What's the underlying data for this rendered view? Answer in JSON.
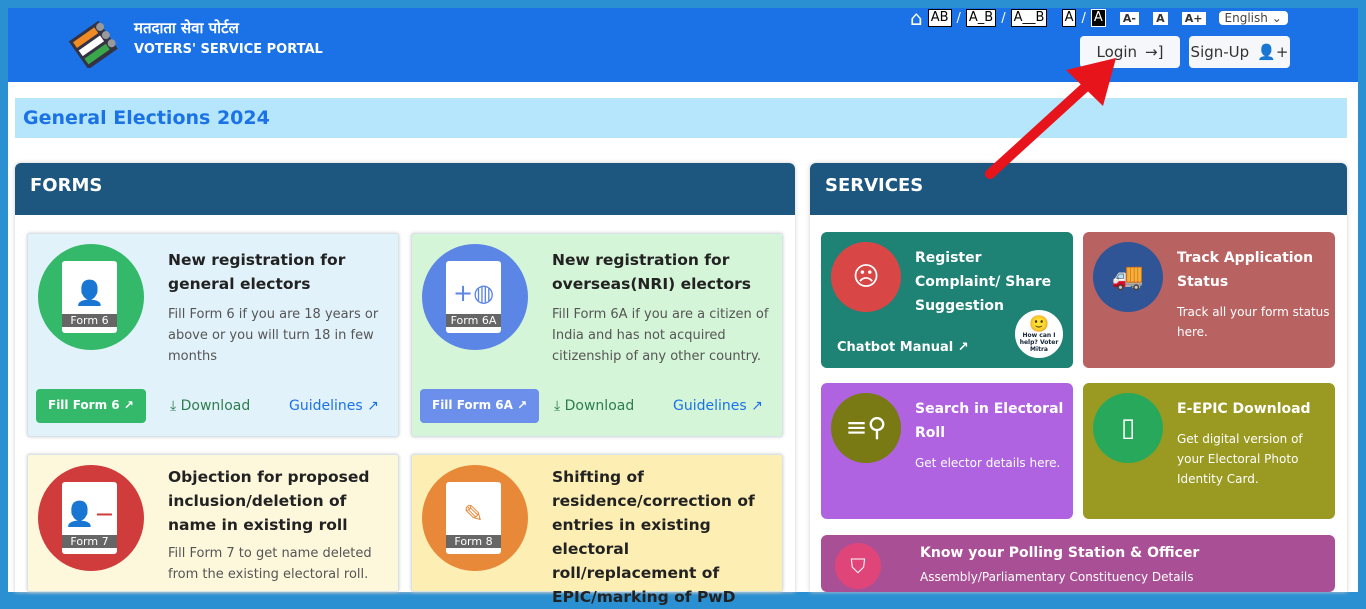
{
  "header": {
    "title_hi": "मतदाता सेवा पोर्टल",
    "title_en": "VOTERS' SERVICE PORTAL",
    "accessibility": [
      "AB",
      "A_B",
      "A__B",
      "A",
      "A",
      "A-",
      "A",
      "A+"
    ],
    "language": "English",
    "login": "Login",
    "signup": "Sign-Up"
  },
  "banner": "General Elections 2024",
  "forms": {
    "title": "FORMS",
    "cards": [
      {
        "badge": "Form 6",
        "title": "New registration for general electors",
        "desc": "Fill Form 6 if you are 18 years or above or you will turn 18 in few months",
        "fill": "Fill Form 6",
        "download": "Download",
        "guidelines": "Guidelines",
        "color": "#34b96a"
      },
      {
        "badge": "Form 6A",
        "title": "New registration for overseas(NRI) electors",
        "desc": "Fill Form 6A if you are a citizen of India and has not acquired citizenship of any other country.",
        "fill": "Fill Form 6A",
        "download": "Download",
        "guidelines": "Guidelines",
        "color": "#5b86e5"
      },
      {
        "badge": "Form 7",
        "title": "Objection for proposed inclusion/deletion of name in existing roll",
        "desc": "Fill Form 7 to get name deleted from the existing electoral roll.",
        "color": "#d03b3b"
      },
      {
        "badge": "Form 8",
        "title": "Shifting of residence/correction of entries in existing electoral roll/replacement of EPIC/marking of PwD",
        "color": "#e8893a"
      }
    ]
  },
  "services": {
    "title": "SERVICES",
    "cards": [
      {
        "title": "Register Complaint/ Share Suggestion",
        "link": "Chatbot Manual",
        "mascot": "How can I help? Voter Mitra",
        "icon": "chat-icon"
      },
      {
        "title": "Track Application Status",
        "desc": "Track all your form status here.",
        "icon": "truck-icon"
      },
      {
        "title": "Search in Electoral Roll",
        "desc": "Get elector details here.",
        "icon": "search-list-icon"
      },
      {
        "title": "E-EPIC Download",
        "desc": "Get digital version of your Electoral Photo Identity Card.",
        "icon": "id-card-icon"
      },
      {
        "title": "Know your Polling Station & Officer",
        "desc": "Assembly/Parliamentary Constituency Details",
        "icon": "shield-star-icon"
      }
    ]
  }
}
